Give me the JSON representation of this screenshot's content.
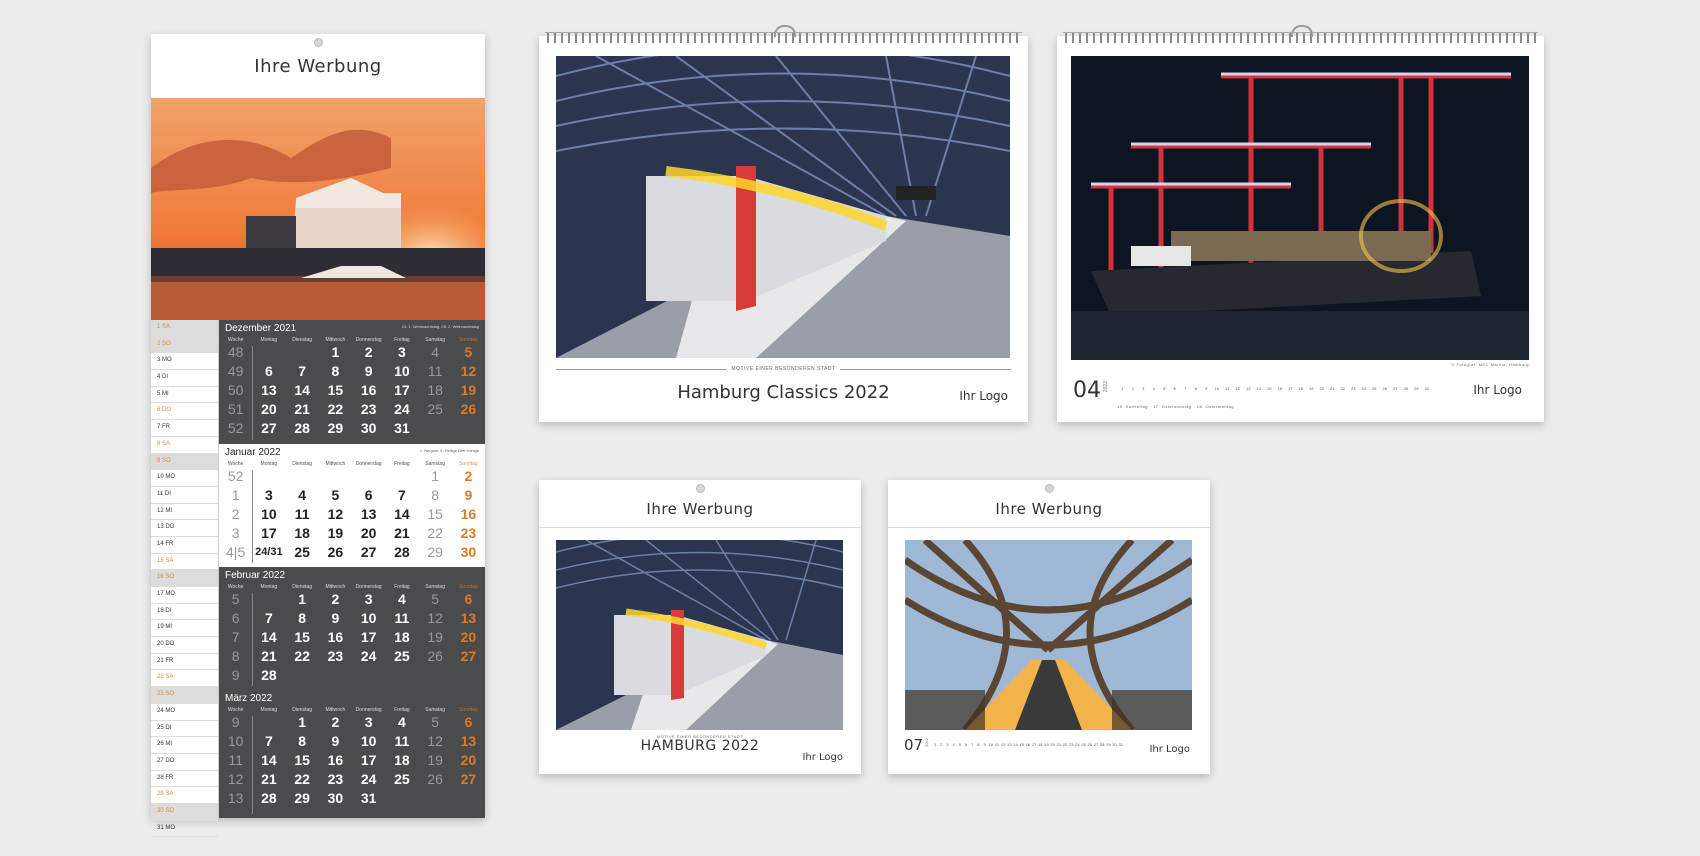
{
  "colors": {
    "background": "#ebeceb",
    "dark_panel": "#4a4b4c",
    "accent_orange": "#e07a1f"
  },
  "tall_calendar": {
    "ad_text": "Ihre Werbung",
    "day_list": [
      {
        "l": "1 SA",
        "c": "we gray"
      },
      {
        "l": "2 SO",
        "c": "we gray"
      },
      {
        "l": "3 MO",
        "c": ""
      },
      {
        "l": "4 DI",
        "c": ""
      },
      {
        "l": "5 MI",
        "c": ""
      },
      {
        "l": "6 DO",
        "c": "we"
      },
      {
        "l": "7 FR",
        "c": ""
      },
      {
        "l": "8 SA",
        "c": "we"
      },
      {
        "l": "9 SO",
        "c": "we gray"
      },
      {
        "l": "10 MO",
        "c": ""
      },
      {
        "l": "11 DI",
        "c": ""
      },
      {
        "l": "12 MI",
        "c": ""
      },
      {
        "l": "13 DO",
        "c": ""
      },
      {
        "l": "14 FR",
        "c": ""
      },
      {
        "l": "15 SA",
        "c": "we"
      },
      {
        "l": "16 SO",
        "c": "we gray"
      },
      {
        "l": "17 MO",
        "c": ""
      },
      {
        "l": "18 DI",
        "c": ""
      },
      {
        "l": "19 MI",
        "c": ""
      },
      {
        "l": "20 DO",
        "c": ""
      },
      {
        "l": "21 FR",
        "c": ""
      },
      {
        "l": "22 SA",
        "c": "we"
      },
      {
        "l": "23 SO",
        "c": "we gray"
      },
      {
        "l": "24 MO",
        "c": ""
      },
      {
        "l": "25 DI",
        "c": ""
      },
      {
        "l": "26 MI",
        "c": ""
      },
      {
        "l": "27 DO",
        "c": ""
      },
      {
        "l": "28 FR",
        "c": ""
      },
      {
        "l": "29 SA",
        "c": "we"
      },
      {
        "l": "30 SO",
        "c": "we gray"
      },
      {
        "l": "31 MO",
        "c": ""
      }
    ],
    "weekdays": [
      "Woche",
      "Montag",
      "Dienstag",
      "Mittwoch",
      "Donnerstag",
      "Freitag",
      "Samstag",
      "Sonntag"
    ],
    "months": [
      {
        "title": "Dezember 2021",
        "holidays": "24. 1. Weihnachtstag, 26. 2. Weihnachtstag",
        "theme": "dark",
        "weeks": [
          [
            "48",
            "",
            "",
            "1",
            "2",
            "3",
            "4",
            "5"
          ],
          [
            "49",
            "6",
            "7",
            "8",
            "9",
            "10",
            "11",
            "12"
          ],
          [
            "50",
            "13",
            "14",
            "15",
            "16",
            "17",
            "18",
            "19"
          ],
          [
            "51",
            "20",
            "21",
            "22",
            "23",
            "24",
            "25",
            "26"
          ],
          [
            "52",
            "27",
            "28",
            "29",
            "30",
            "31",
            "",
            ""
          ]
        ]
      },
      {
        "title": "Januar 2022",
        "holidays": "1. Neujahr, 6. Heilige Drei Könige",
        "theme": "light",
        "weeks": [
          [
            "52",
            "",
            "",
            "",
            "",
            "",
            "1",
            "2"
          ],
          [
            "1",
            "3",
            "4",
            "5",
            "6",
            "7",
            "8",
            "9"
          ],
          [
            "2",
            "10",
            "11",
            "12",
            "13",
            "14",
            "15",
            "16"
          ],
          [
            "3",
            "17",
            "18",
            "19",
            "20",
            "21",
            "22",
            "23"
          ],
          [
            "4|5",
            "24/31",
            "25",
            "26",
            "27",
            "28",
            "29",
            "30"
          ]
        ]
      },
      {
        "title": "Februar 2022",
        "holidays": "",
        "theme": "dark",
        "weeks": [
          [
            "5",
            "",
            "1",
            "2",
            "3",
            "4",
            "5",
            "6"
          ],
          [
            "6",
            "7",
            "8",
            "9",
            "10",
            "11",
            "12",
            "13"
          ],
          [
            "7",
            "14",
            "15",
            "16",
            "17",
            "18",
            "19",
            "20"
          ],
          [
            "8",
            "21",
            "22",
            "23",
            "24",
            "25",
            "26",
            "27"
          ],
          [
            "9",
            "28",
            "",
            "",
            "",
            "",
            "",
            ""
          ]
        ]
      },
      {
        "title": "März 2022",
        "holidays": "",
        "theme": "dark",
        "weeks": [
          [
            "9",
            "",
            "1",
            "2",
            "3",
            "4",
            "5",
            "6"
          ],
          [
            "10",
            "7",
            "8",
            "9",
            "10",
            "11",
            "12",
            "13"
          ],
          [
            "11",
            "14",
            "15",
            "16",
            "17",
            "18",
            "19",
            "20"
          ],
          [
            "12",
            "21",
            "22",
            "23",
            "24",
            "25",
            "26",
            "27"
          ],
          [
            "13",
            "28",
            "29",
            "30",
            "31",
            "",
            "",
            ""
          ]
        ]
      }
    ]
  },
  "landscape_1": {
    "subtitle": "Motive einer besonderen Stadt",
    "title": "Hamburg Classics 2022",
    "logo": "Ihr Logo"
  },
  "landscape_2": {
    "month_num": "04",
    "year": "2022",
    "logo": "Ihr Logo",
    "credit": "© Fotograf: MSC Marina, Hamburg",
    "notes": "15. Karfreitag · 17. Ostersonntag · 18. Ostermontag"
  },
  "small_1": {
    "ad_text": "Ihre Werbung",
    "subtitle": "Motive einer besonderen Stadt",
    "title": "HAMBURG 2022",
    "logo": "Ihr Logo"
  },
  "small_2": {
    "ad_text": "Ihre Werbung",
    "month_num": "07",
    "year": "2022",
    "logo": "Ihr Logo"
  },
  "april_days": [
    "1",
    "2",
    "3",
    "4",
    "5",
    "6",
    "7",
    "8",
    "9",
    "10",
    "11",
    "12",
    "13",
    "14",
    "15",
    "16",
    "17",
    "18",
    "19",
    "20",
    "21",
    "22",
    "23",
    "24",
    "25",
    "26",
    "27",
    "28",
    "29",
    "30"
  ],
  "july_days": [
    "1",
    "2",
    "3",
    "4",
    "5",
    "6",
    "7",
    "8",
    "9",
    "10",
    "11",
    "12",
    "13",
    "14",
    "15",
    "16",
    "17",
    "18",
    "19",
    "20",
    "21",
    "22",
    "23",
    "24",
    "25",
    "26",
    "27",
    "28",
    "29",
    "30",
    "31"
  ]
}
